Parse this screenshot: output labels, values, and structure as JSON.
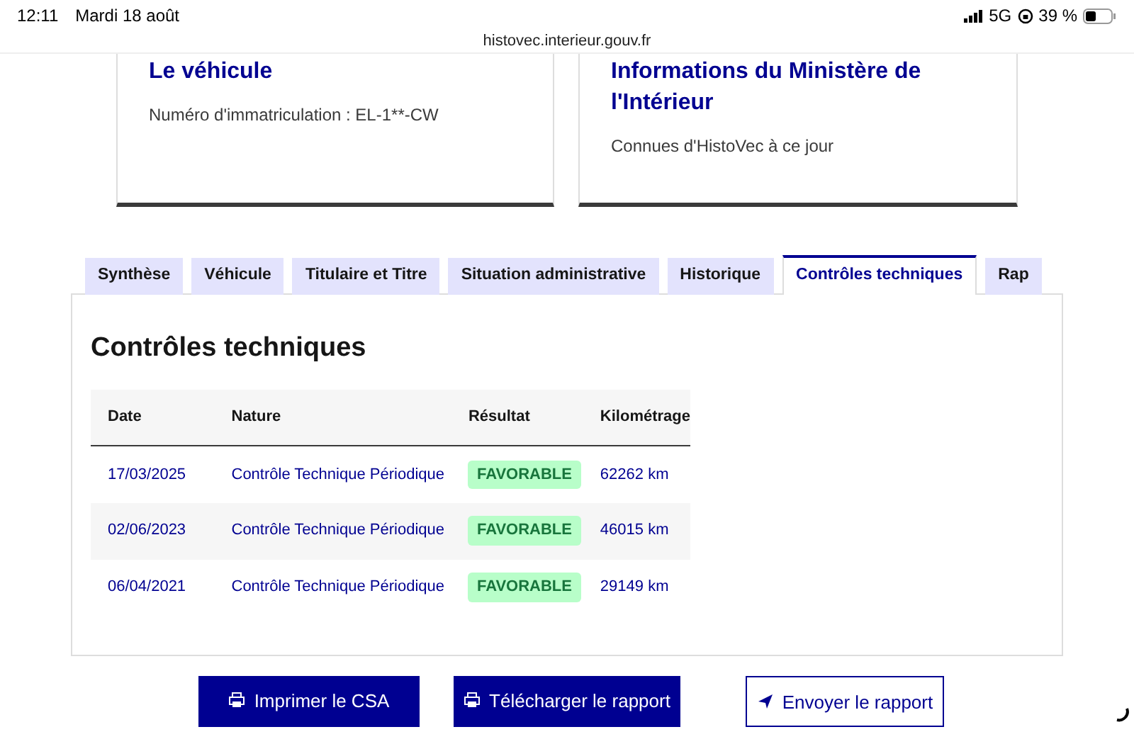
{
  "status_bar": {
    "time": "12:11",
    "date": "Mardi 18 août",
    "network": "5G",
    "battery": "39 %"
  },
  "url": "histovec.interieur.gouv.fr",
  "cards": [
    {
      "title": "Le véhicule",
      "text": "Numéro d'immatriculation : EL-1**-CW"
    },
    {
      "title": "Informations du Ministère de l'Intérieur",
      "text": "Connues d'HistoVec à ce jour"
    }
  ],
  "tabs": [
    {
      "label": "Synthèse",
      "selected": false
    },
    {
      "label": "Véhicule",
      "selected": false
    },
    {
      "label": "Titulaire et Titre",
      "selected": false
    },
    {
      "label": "Situation administrative",
      "selected": false
    },
    {
      "label": "Historique",
      "selected": false
    },
    {
      "label": "Contrôles techniques",
      "selected": true
    },
    {
      "label": "Rap",
      "selected": false
    }
  ],
  "panel": {
    "title": "Contrôles techniques",
    "table": {
      "columns": [
        "Date",
        "Nature",
        "Résultat",
        "Kilométrage"
      ],
      "rows": [
        [
          "17/03/2025",
          "Contrôle Technique Périodique",
          "FAVORABLE",
          "62262 km"
        ],
        [
          "02/06/2023",
          "Contrôle Technique Périodique",
          "FAVORABLE",
          "46015 km"
        ],
        [
          "06/04/2021",
          "Contrôle Technique Périodique",
          "FAVORABLE",
          "29149 km"
        ]
      ]
    }
  },
  "buttons": [
    {
      "label": "Imprimer le CSA",
      "kind": "primary"
    },
    {
      "label": "Télécharger le rapport",
      "kind": "primary"
    },
    {
      "label": "Envoyer le rapport",
      "kind": "secondary"
    }
  ]
}
